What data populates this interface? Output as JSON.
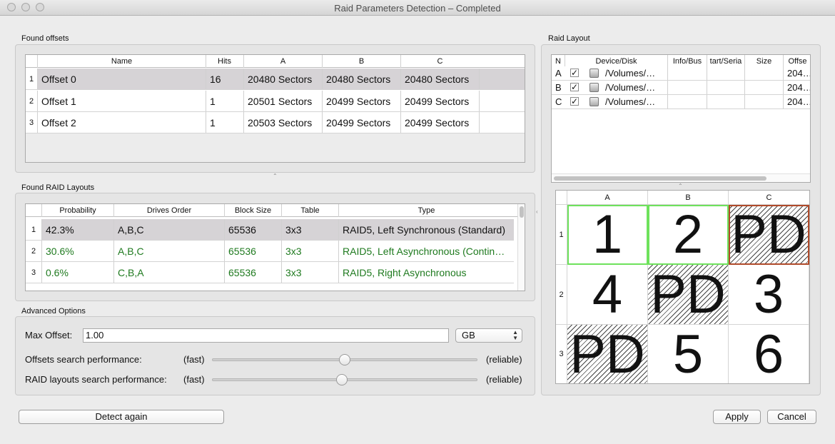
{
  "window": {
    "title": "Raid Parameters Detection – Completed"
  },
  "offsets": {
    "section_label": "Found offsets",
    "columns": [
      "Name",
      "Hits",
      "A",
      "B",
      "C"
    ],
    "rows": [
      {
        "num": "1",
        "name": "Offset 0",
        "hits": "16",
        "a": "20480 Sectors",
        "b": "20480 Sectors",
        "c": "20480 Sectors"
      },
      {
        "num": "2",
        "name": "Offset 1",
        "hits": "1",
        "a": "20501 Sectors",
        "b": "20499 Sectors",
        "c": "20499 Sectors"
      },
      {
        "num": "3",
        "name": "Offset 2",
        "hits": "1",
        "a": "20503 Sectors",
        "b": "20499 Sectors",
        "c": "20499 Sectors"
      }
    ]
  },
  "layouts": {
    "section_label": "Found RAID Layouts",
    "columns": [
      "Probability",
      "Drives Order",
      "Block Size",
      "Table",
      "Type"
    ],
    "rows": [
      {
        "num": "1",
        "probability": "42.3%",
        "order": "A,B,C",
        "block": "65536",
        "table": "3x3",
        "type": "RAID5, Left Synchronous (Standard)"
      },
      {
        "num": "2",
        "probability": "30.6%",
        "order": "A,B,C",
        "block": "65536",
        "table": "3x3",
        "type": "RAID5, Left Asynchronous (Contin…"
      },
      {
        "num": "3",
        "probability": "0.6%",
        "order": "C,B,A",
        "block": "65536",
        "table": "3x3",
        "type": "RAID5, Right Asynchronous"
      }
    ]
  },
  "advanced": {
    "section_label": "Advanced Options",
    "max_offset_label": "Max Offset:",
    "max_offset_value": "1.00",
    "unit": "GB",
    "offsets_perf_label": "Offsets search performance:",
    "layouts_perf_label": "RAID layouts search performance:",
    "fast": "(fast)",
    "reliable": "(reliable)",
    "offsets_perf_level": 0.5,
    "layouts_perf_level": 0.49
  },
  "raid_layout": {
    "section_label": "Raid Layout",
    "columns": [
      "N",
      "Device/Disk",
      "Info/Bus",
      "tart/Seria",
      "Size",
      "Offse"
    ],
    "devices": [
      {
        "n": "A",
        "checked": "✓",
        "device": "/Volumes/…",
        "offset": "204…"
      },
      {
        "n": "B",
        "checked": "✓",
        "device": "/Volumes/…",
        "offset": "204…"
      },
      {
        "n": "C",
        "checked": "✓",
        "device": "/Volumes/…",
        "offset": "204…"
      }
    ],
    "grid_columns": [
      "A",
      "B",
      "C"
    ],
    "grid_rows": [
      "1",
      "2",
      "3"
    ],
    "grid": [
      [
        "1",
        "2",
        "PD"
      ],
      [
        "4",
        "PD",
        "3"
      ],
      [
        "PD",
        "5",
        "6"
      ]
    ]
  },
  "buttons": {
    "detect_again": "Detect again",
    "apply": "Apply",
    "cancel": "Cancel"
  }
}
